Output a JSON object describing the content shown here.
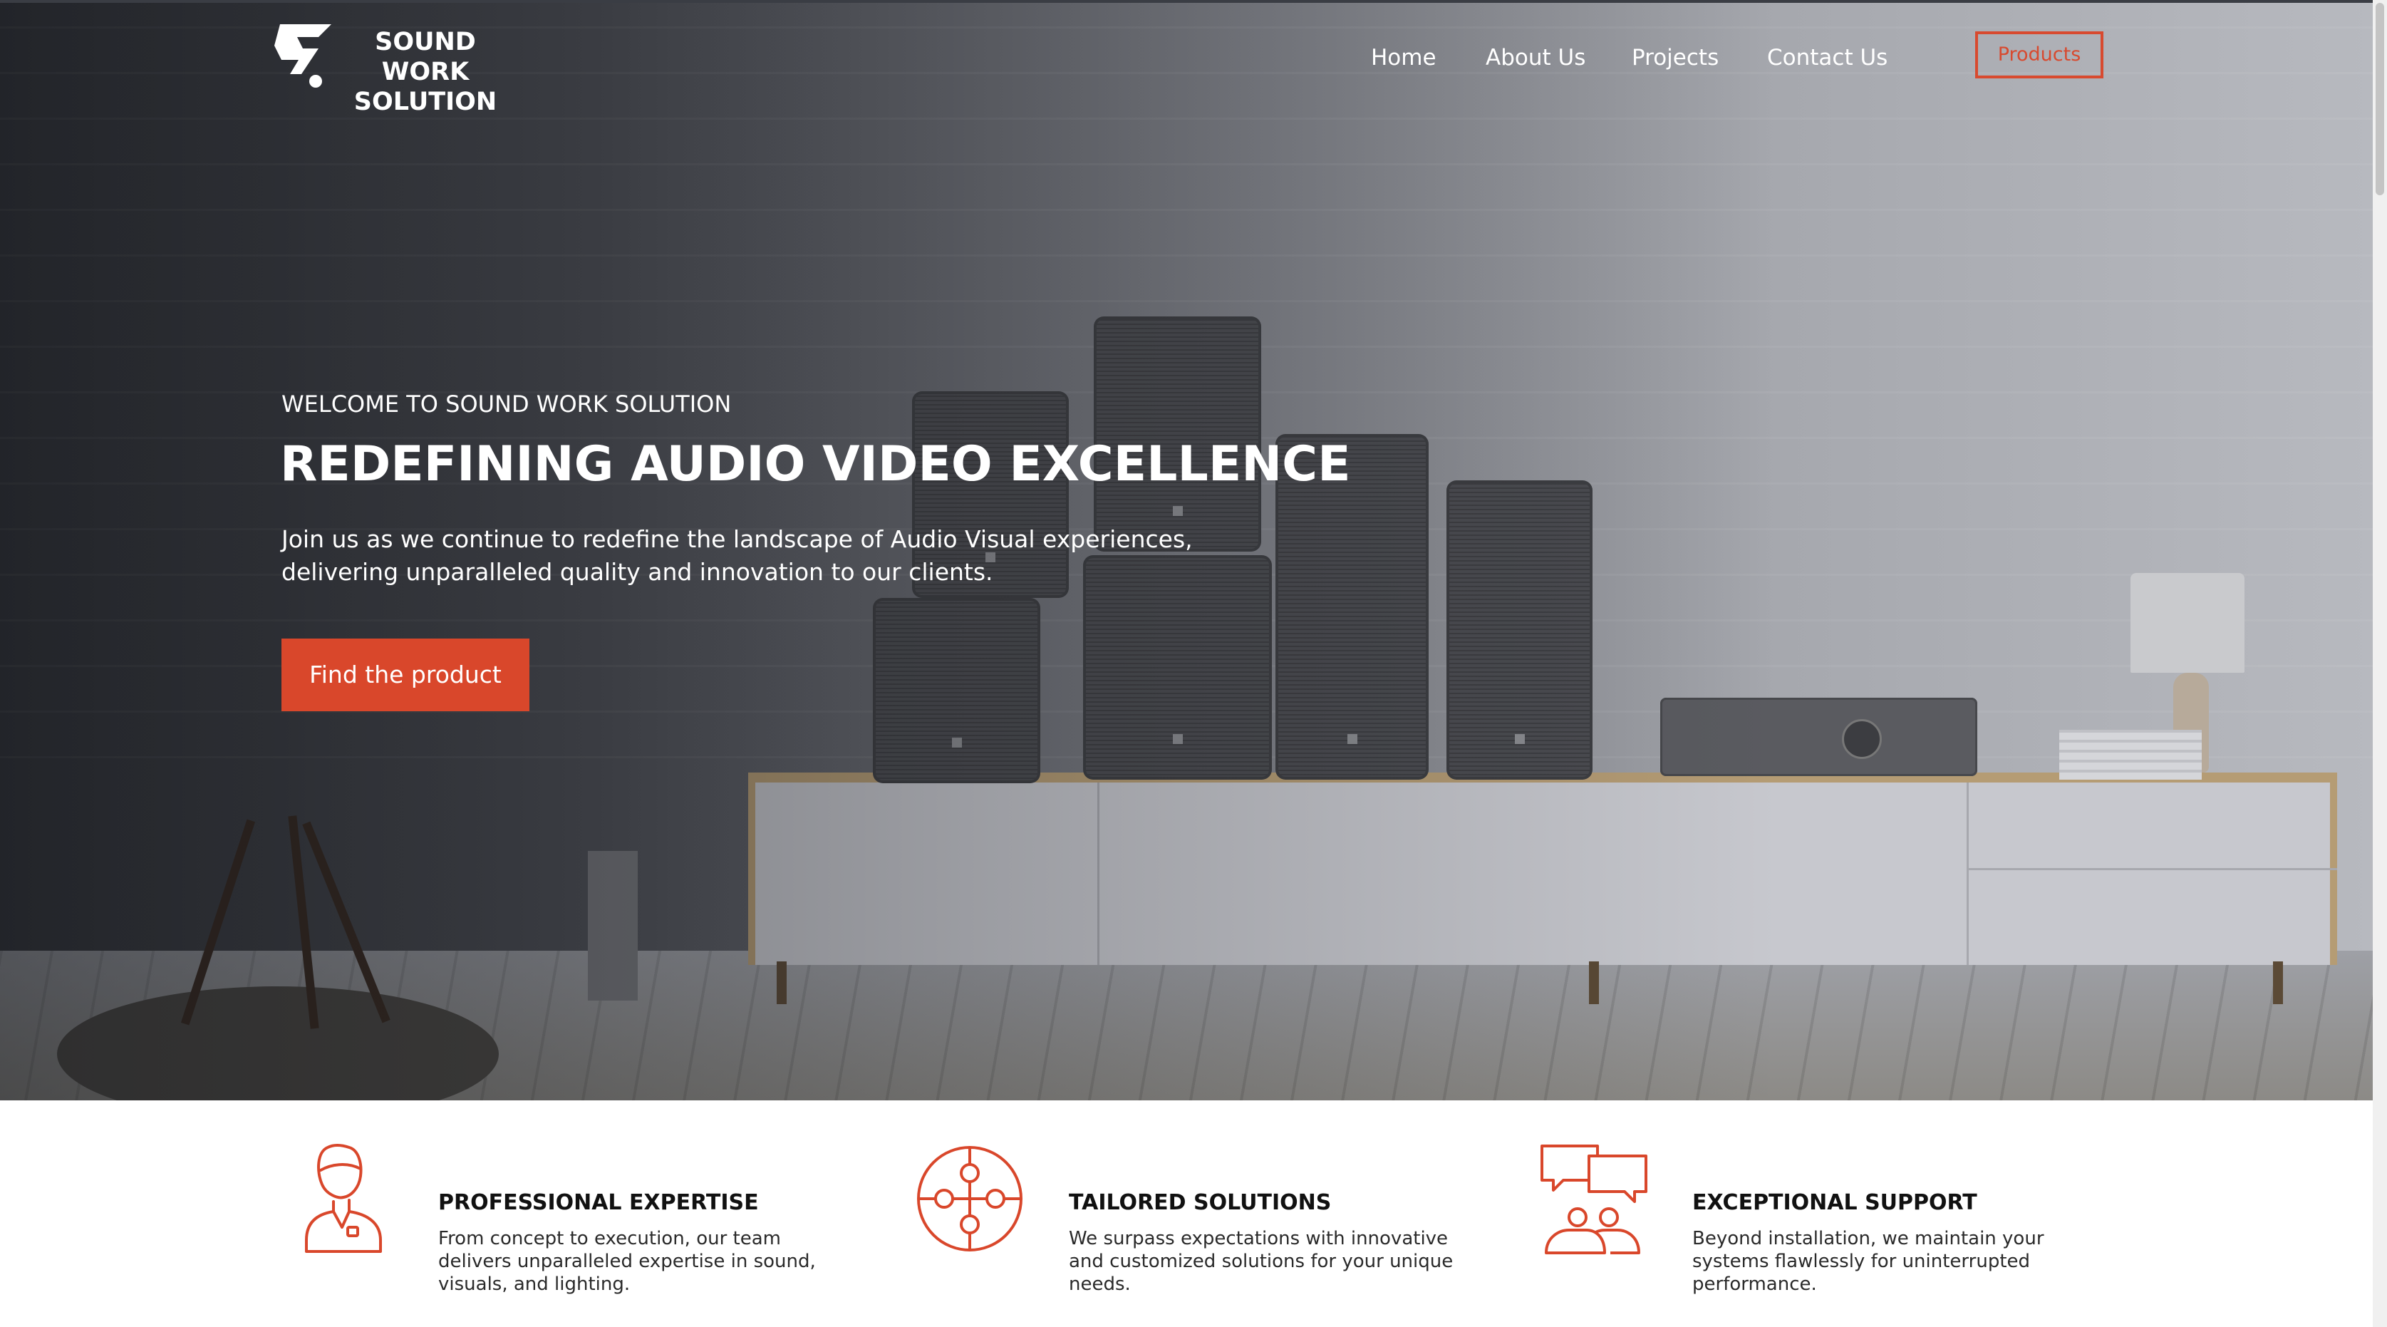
{
  "brand": {
    "name_line1": "SOUND WORK",
    "name_line2": "SOLUTION",
    "accent_color": "#d9472b"
  },
  "nav": {
    "items": [
      {
        "label": "Home"
      },
      {
        "label": "About Us"
      },
      {
        "label": "Projects"
      },
      {
        "label": "Contact Us"
      }
    ],
    "cta_label": "Products"
  },
  "hero": {
    "eyebrow": "WELCOME TO SOUND WORK SOLUTION",
    "headline": "REDEFINING AUDIO VIDEO EXCELLENCE",
    "subtext_line1": "Join us as we continue to redefine the landscape of Audio Visual experiences,",
    "subtext_line2": "delivering unparalleled quality and innovation to our clients.",
    "cta_label": "Find the product"
  },
  "features": [
    {
      "icon": "person-icon",
      "title": "PROFESSIONAL EXPERTISE",
      "line1": "From concept to execution, our team",
      "line2": "delivers unparalleled expertise in sound,",
      "line3": "visuals, and lighting."
    },
    {
      "icon": "puzzle-icon",
      "title": "TAILORED SOLUTIONS",
      "line1": "We surpass expectations with innovative",
      "line2": "and customized solutions for your unique",
      "line3": "needs."
    },
    {
      "icon": "support-chat-icon",
      "title": "EXCEPTIONAL SUPPORT",
      "line1": "Beyond installation, we maintain your",
      "line2": "systems flawlessly for uninterrupted",
      "line3": "performance."
    }
  ]
}
